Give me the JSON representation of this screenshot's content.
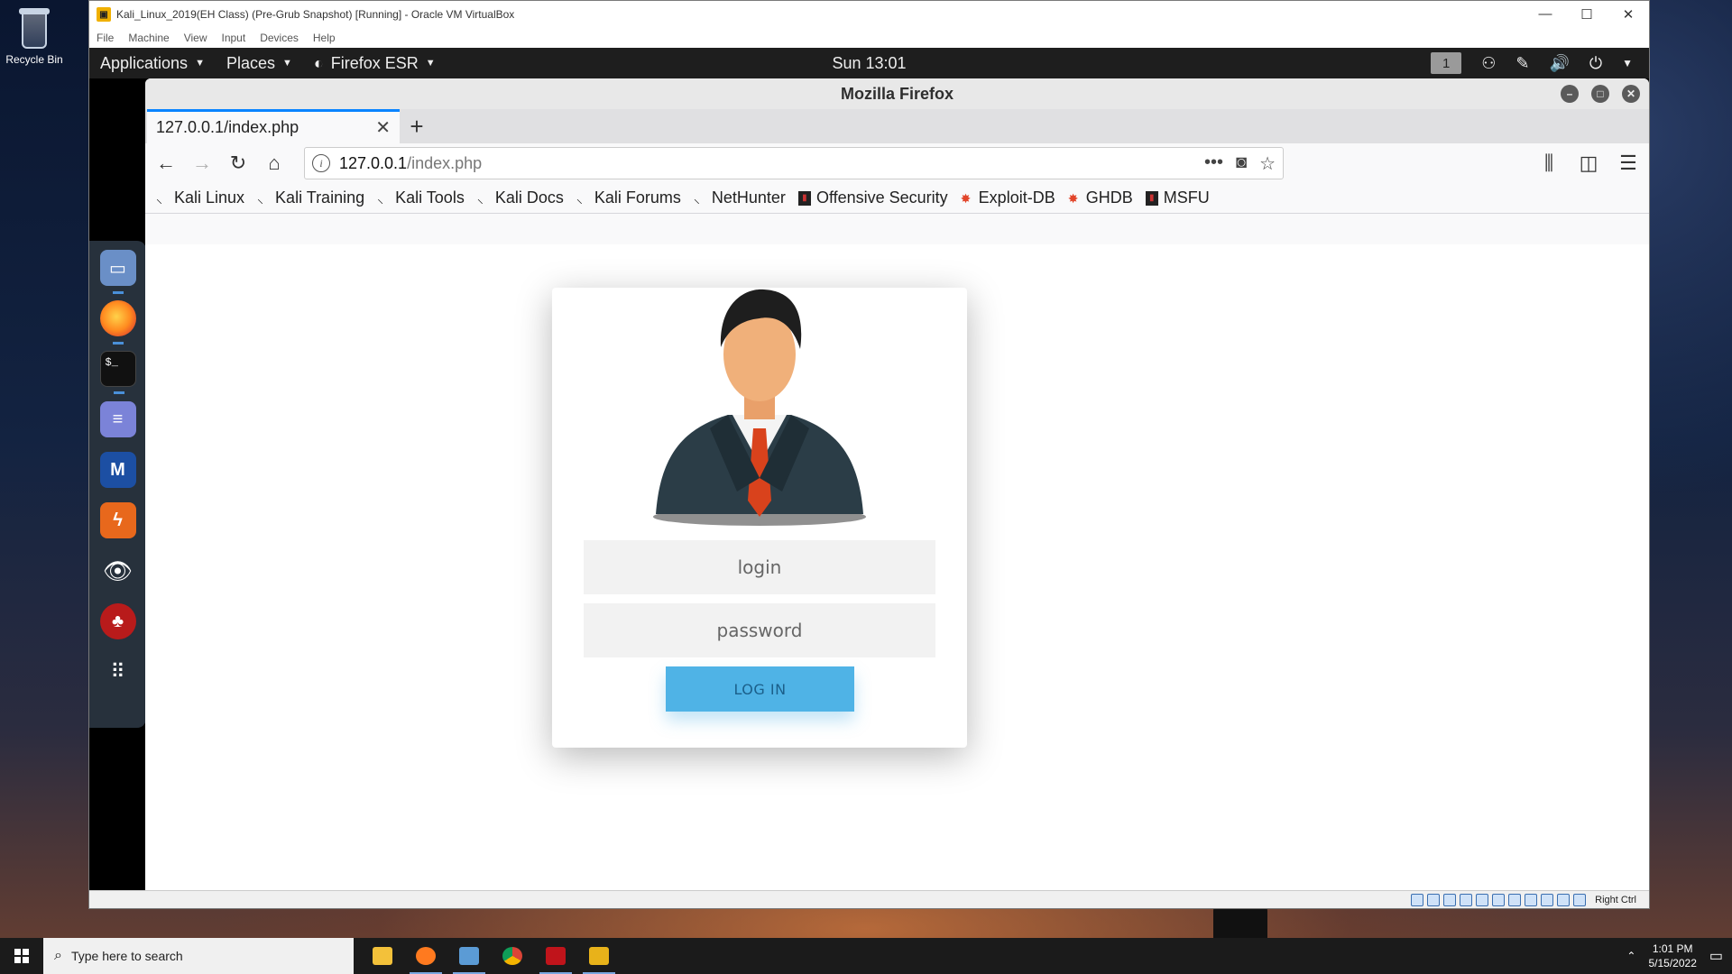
{
  "desktop": {
    "recycle_bin": "Recycle Bin"
  },
  "vbox": {
    "title": "Kali_Linux_2019(EH Class) (Pre-Grub Snapshot) [Running] - Oracle VM VirtualBox",
    "menu": [
      "File",
      "Machine",
      "View",
      "Input",
      "Devices",
      "Help"
    ],
    "status_hostkey": "Right Ctrl"
  },
  "gnome": {
    "applications": "Applications",
    "places": "Places",
    "firefox_menu": "Firefox ESR",
    "clock": "Sun 13:01",
    "workspace": "1"
  },
  "dock": [
    "files-icon",
    "firefox-icon",
    "terminal-icon",
    "notes-icon",
    "metasploit-icon",
    "burpsuite-icon",
    "eye-icon",
    "cherrytree-icon",
    "app-grid-icon"
  ],
  "firefox": {
    "window_title": "Mozilla Firefox",
    "tab_title": "127.0.0.1/index.php",
    "url_host": "127.0.0.1",
    "url_path": "/index.php",
    "bookmarks": [
      "Kali Linux",
      "Kali Training",
      "Kali Tools",
      "Kali Docs",
      "Kali Forums",
      "NetHunter",
      "Offensive Security",
      "Exploit-DB",
      "GHDB",
      "MSFU"
    ]
  },
  "page": {
    "login_placeholder": "login",
    "password_placeholder": "password",
    "login_button": "LOG IN"
  },
  "taskbar": {
    "search_placeholder": "Type here to search",
    "time": "1:01 PM",
    "date": "5/15/2022"
  },
  "colors": {
    "accent_tab": "#0a84ff",
    "login_button": "#4fb3e6",
    "kali_panel": "#1e1e1e",
    "dock": "#27313c"
  }
}
